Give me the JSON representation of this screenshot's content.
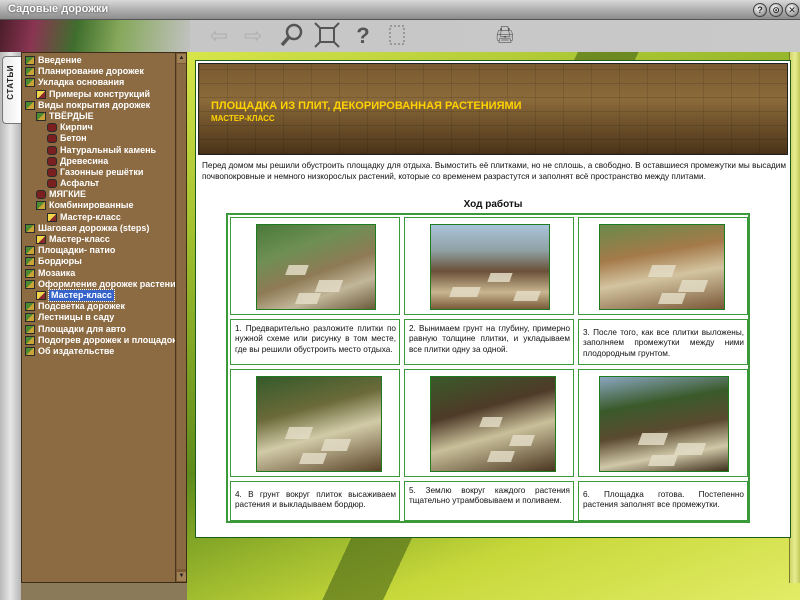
{
  "window": {
    "title": "Садовые дорожки",
    "controls": [
      "?",
      "⊙",
      "✕"
    ]
  },
  "toolbar": {
    "icons": [
      "back-arrow-icon",
      "forward-arrow-icon",
      "magnifier-icon",
      "fit-screen-icon",
      "help-icon",
      "frame-icon",
      "print-icon"
    ]
  },
  "sidebar": {
    "tab_label": "СТАТЬИ",
    "items": [
      {
        "label": "Введение",
        "level": 0,
        "icon": "book"
      },
      {
        "label": "Планирование дорожек",
        "level": 0,
        "icon": "book"
      },
      {
        "label": "Укладка основания",
        "level": 0,
        "icon": "book"
      },
      {
        "label": "Примеры конструкций",
        "level": 1,
        "icon": "page"
      },
      {
        "label": "Виды покрытия дорожек",
        "level": 0,
        "icon": "book"
      },
      {
        "label": "ТВЁРДЫЕ",
        "level": 1,
        "icon": "book"
      },
      {
        "label": "Кирпич",
        "level": 2,
        "icon": "bug"
      },
      {
        "label": "Бетон",
        "level": 2,
        "icon": "bug"
      },
      {
        "label": "Натуральный камень",
        "level": 2,
        "icon": "bug"
      },
      {
        "label": "Древесина",
        "level": 2,
        "icon": "bug"
      },
      {
        "label": "Газонные решётки",
        "level": 2,
        "icon": "bug"
      },
      {
        "label": "Асфальт",
        "level": 2,
        "icon": "bug"
      },
      {
        "label": "МЯГКИЕ",
        "level": 1,
        "icon": "bug"
      },
      {
        "label": "Комбинированные",
        "level": 1,
        "icon": "book"
      },
      {
        "label": "Мастер-класс",
        "level": 2,
        "icon": "page"
      },
      {
        "label": "Шаговая дорожка (steps)",
        "level": 0,
        "icon": "book"
      },
      {
        "label": "Мастер-класс",
        "level": 1,
        "icon": "page"
      },
      {
        "label": "Площадки- патио",
        "level": 0,
        "icon": "book"
      },
      {
        "label": "Бордюры",
        "level": 0,
        "icon": "book"
      },
      {
        "label": "Мозаика",
        "level": 0,
        "icon": "book"
      },
      {
        "label": "Оформление дорожек растения",
        "level": 0,
        "icon": "book"
      },
      {
        "label": "Мастер-класс",
        "level": 1,
        "icon": "page",
        "selected": true
      },
      {
        "label": "Подсветка дорожек",
        "level": 0,
        "icon": "book"
      },
      {
        "label": "Лестницы в саду",
        "level": 0,
        "icon": "book"
      },
      {
        "label": "Площадки для авто",
        "level": 0,
        "icon": "book"
      },
      {
        "label": "Подогрев дорожек и площадок",
        "level": 0,
        "icon": "book"
      },
      {
        "label": "Об издательстве",
        "level": 0,
        "icon": "book"
      }
    ]
  },
  "article": {
    "title": "ПЛОЩАДКА ИЗ ПЛИТ, ДЕКОРИРОВАННАЯ РАСТЕНИЯМИ",
    "subtitle": "МАСТЕР-КЛАСС",
    "intro": "Перед домом мы решили обустроить площадку для отдыха. Вымостить её плитками, но не сплошь, а свободно. В оставшиеся промежутки мы высадим почвопокровные и немного низкорослых растений, которые со временем разрастутся и заполнят всё пространство между плитами.",
    "steps_title": "Ход работы",
    "steps": [
      {
        "caption": "1. Предварительно разложите плитки по нужной схеме или рисунку в том месте, где вы решили обустроить место отдыха."
      },
      {
        "caption": "2. Вынимаем грунт на глубину, примерно равную толщине плитки, и укладываем все плитки одну за одной."
      },
      {
        "caption": "3. После того, как все плитки выложены, заполняем промежутки между ними плодородным грунтом."
      },
      {
        "caption": "4. В грунт вокруг плиток высаживаем растения и выкладываем бордюр."
      },
      {
        "caption": "5. Землю вокруг каждого растения тщательно утрамбовываем и поливаем."
      },
      {
        "caption": "6. Площадка готова. Постепенно растения заполнят все промежутки."
      }
    ]
  }
}
